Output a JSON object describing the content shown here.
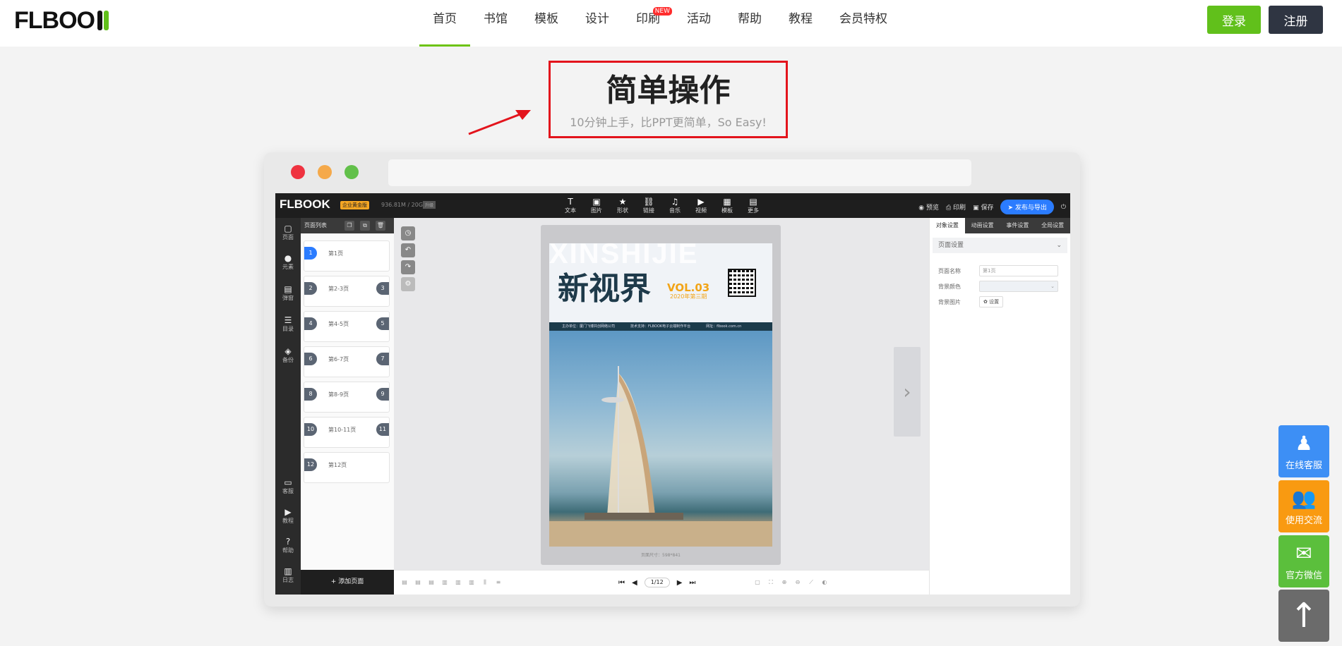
{
  "brand": {
    "logo_text": "FLBOO",
    "accent": "#61c01b",
    "dark": "#2f3542"
  },
  "nav": {
    "items": [
      {
        "label": "首页",
        "active": true
      },
      {
        "label": "书馆"
      },
      {
        "label": "模板"
      },
      {
        "label": "设计"
      },
      {
        "label": "印刷",
        "badge": "NEW"
      },
      {
        "label": "活动"
      },
      {
        "label": "帮助"
      },
      {
        "label": "教程"
      },
      {
        "label": "会员特权"
      }
    ],
    "login": "登录",
    "register": "注册"
  },
  "headline": {
    "title": "简单操作",
    "subtitle": "10分钟上手，比PPT更简单，So Easy!"
  },
  "editor": {
    "logo": "FLBOOK",
    "plan_badge": "企业黄金版",
    "storage": "936.81M / 20G",
    "upgrade": "升级",
    "tools": [
      {
        "icon": "T",
        "label": "文本"
      },
      {
        "icon": "▣",
        "label": "图片"
      },
      {
        "icon": "★",
        "label": "形状"
      },
      {
        "icon": "⛓",
        "label": "链接"
      },
      {
        "icon": "♫",
        "label": "音乐"
      },
      {
        "icon": "▶",
        "label": "视频"
      },
      {
        "icon": "▦",
        "label": "模板"
      },
      {
        "icon": "▤",
        "label": "更多"
      }
    ],
    "right_tools": {
      "preview": "预览",
      "print": "印刷",
      "save": "保存",
      "publish": "发布与导出"
    },
    "left_bar": [
      {
        "icon": "▢",
        "label": "页面"
      },
      {
        "icon": "●",
        "label": "元素"
      },
      {
        "icon": "▤",
        "label": "弹窗"
      },
      {
        "icon": "☰",
        "label": "目录"
      },
      {
        "icon": "◈",
        "label": "备份"
      },
      {
        "icon": "▭",
        "label": "客服"
      },
      {
        "icon": "▶",
        "label": "教程"
      },
      {
        "icon": "?",
        "label": "帮助"
      },
      {
        "icon": "▥",
        "label": "日志"
      }
    ],
    "page_list_title": "页面列表",
    "pages": [
      {
        "n": "1",
        "label": "第1页",
        "r": ""
      },
      {
        "n": "2",
        "label": "第2-3页",
        "r": "3"
      },
      {
        "n": "4",
        "label": "第4-5页",
        "r": "5"
      },
      {
        "n": "6",
        "label": "第6-7页",
        "r": "7"
      },
      {
        "n": "8",
        "label": "第8-9页",
        "r": "9"
      },
      {
        "n": "10",
        "label": "第10-11页",
        "r": "11"
      },
      {
        "n": "12",
        "label": "第12页",
        "r": ""
      }
    ],
    "add_page": "+ 添加页面",
    "cover": {
      "bg_text": "XINSHIJIE",
      "title": "新视界",
      "vol": "VOL.03",
      "vol_sub": "2020年第三期",
      "info": [
        "主办单位：厦门飞博共创网络公司",
        "技术支持：FLBOOK电子云端制作平台",
        "网址：flbook.com.cn"
      ]
    },
    "page_size": "页面尺寸：598*841",
    "pager": {
      "value": "1/12"
    },
    "right_tabs": [
      "对象设置",
      "动画设置",
      "事件设置",
      "全局设置"
    ],
    "section": "页面设置",
    "fields": {
      "name_label": "页面名称",
      "name_placeholder": "第1页",
      "bgcolor_label": "背景颜色",
      "bgimage_label": "背景图片",
      "bgimage_btn": "设置"
    }
  },
  "floats": [
    {
      "icon": "♟",
      "label": "在线客服",
      "color": "#3d8ff5"
    },
    {
      "icon": "👥",
      "label": "使用交流",
      "color": "#f99a11"
    },
    {
      "icon": "✉",
      "label": "官方微信",
      "color": "#5bbf3c"
    }
  ],
  "to_top_icon": "↑"
}
